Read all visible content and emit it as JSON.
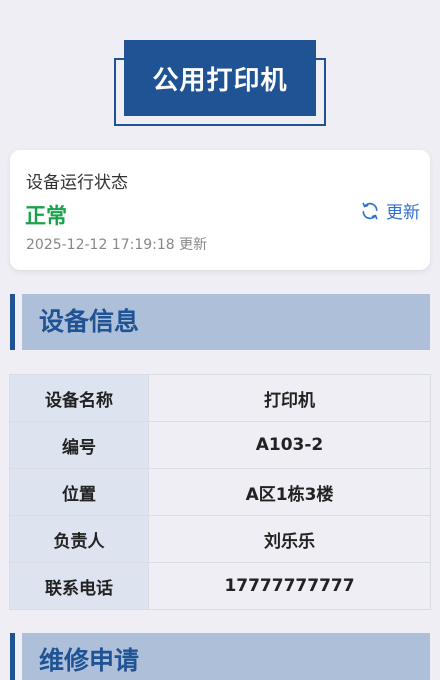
{
  "header": {
    "title": "公用打印机"
  },
  "status_card": {
    "label": "设备运行状态",
    "value": "正常",
    "updated_time": "2025-12-12 17:19:18 更新",
    "refresh_label": "更新",
    "value_color": "#16a34a",
    "accent_color": "#2f6fd0"
  },
  "device_info": {
    "section_title": "设备信息",
    "rows": [
      {
        "key": "设备名称",
        "value": "打印机"
      },
      {
        "key": "编号",
        "value": "A103-2"
      },
      {
        "key": "位置",
        "value": "A区1栋3楼"
      },
      {
        "key": "负责人",
        "value": "刘乐乐"
      },
      {
        "key": "联系电话",
        "value": "17777777777"
      }
    ]
  },
  "repair": {
    "section_title": "维修申请"
  },
  "icons": {
    "refresh": "refresh-icon"
  },
  "colors": {
    "brand": "#1f5394",
    "section_bg": "#aebfd9",
    "page_bg": "#eeeef4"
  }
}
